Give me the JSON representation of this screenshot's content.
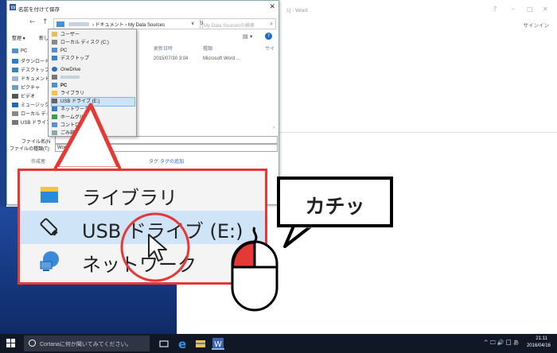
{
  "dialog": {
    "title": "名前を付けて保存",
    "close_glyph": "✕",
    "breadcrumb": "› ドキュメント › My Data Sources",
    "search_placeholder": "My Data Sourcesの検索",
    "organize": "整理 ▾",
    "new_folder": "新し",
    "nav_items": [
      "PC",
      "ダウンロード",
      "デスクトップ",
      "ドキュメント",
      "ピクチャ",
      "ビデオ",
      "ミュージック",
      "ローカル ディ",
      "USB ドライブ"
    ],
    "columns": [
      "更新日時",
      "種類",
      "サイ"
    ],
    "file_row": {
      "date": "2015/07/30 3:04",
      "type": "Microsoft Word ..."
    },
    "filename_label": "ファイル名(N",
    "filetype_label": "ファイルの種類(T):",
    "filetype_value": "Word",
    "author_label": "作成者:",
    "tag_label": "タグ:",
    "tag_link": "タグの追加"
  },
  "dropdown": {
    "items": [
      "ユーザー",
      "ローカル ディスク (C:)",
      "PC",
      "デスクトップ",
      "OneDrive",
      "",
      "PC",
      "ライブラリ",
      "USB ドライブ (E:)",
      "ネットワーク",
      "ホームグル",
      "コントロ",
      "ごみ箱"
    ],
    "selected_index": 8
  },
  "word": {
    "title": "1] - Word",
    "signin": "サインイン",
    "buttons": [
      "?",
      "–",
      "□",
      "✕"
    ]
  },
  "zoom": {
    "items": [
      "ライブラリ",
      "USB ドライブ (E:)",
      "ネットワーク"
    ]
  },
  "callout": {
    "text": "カチッ"
  },
  "taskbar": {
    "search_text": "Cortanaに何か聞いてみてください。",
    "time": "21:11",
    "date": "2016/04/16",
    "tray": "^ 🖵 🔊 囗 あ"
  }
}
